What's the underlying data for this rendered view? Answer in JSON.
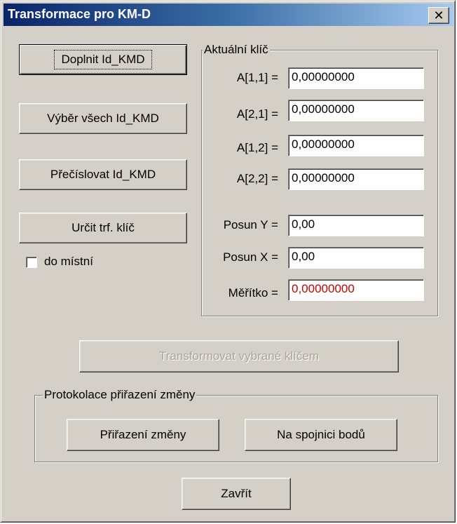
{
  "window": {
    "title": "Transformace pro KM-D",
    "close_icon": "close-icon"
  },
  "buttons": {
    "doplnit": "Doplnit Id_KMD",
    "vyber": "Výběr všech Id_KMD",
    "precislovat": "Přečíslovat Id_KMD",
    "urcit": "Určit trf. klíč",
    "transformovat": "Transformovat vybrané klíčem",
    "prirazeni": "Přiřazení změny",
    "spojnice": "Na spojnici bodů",
    "zavrit": "Zavřít"
  },
  "checkbox": {
    "label": "do místní",
    "checked": false
  },
  "key_group": {
    "legend": "Aktuální klíč",
    "fields": [
      {
        "label": "A[1,1] =",
        "value": "0,00000000"
      },
      {
        "label": "A[2,1] =",
        "value": "0,00000000"
      },
      {
        "label": "A[1,2] =",
        "value": "0,00000000"
      },
      {
        "label": "A[2,2] =",
        "value": "0,00000000"
      },
      {
        "label": "Posun Y =",
        "value": "0,00"
      },
      {
        "label": "Posun X =",
        "value": "0,00"
      },
      {
        "label": "Měřítko =",
        "value": "0,00000000"
      }
    ]
  },
  "protocol_group": {
    "legend": "Protokolace přiřazení změny"
  },
  "colors": {
    "scale_value": "#cc0000",
    "disabled_text": "#a9a59c"
  }
}
